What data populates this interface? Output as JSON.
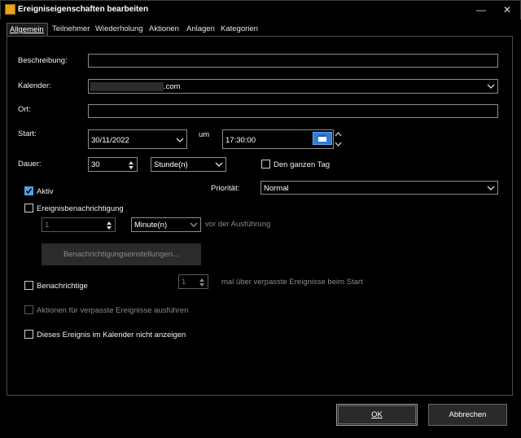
{
  "window": {
    "title": "Ereigniseigenschaften bearbeiten",
    "minimize": "—",
    "close": "✕"
  },
  "tabs": [
    {
      "label": "Allgemein",
      "active": true
    },
    {
      "label": "Teilnehmer"
    },
    {
      "label": "Wiederholung"
    },
    {
      "label": "Aktionen"
    },
    {
      "label": "Anlagen"
    },
    {
      "label": "Kategorien"
    }
  ],
  "form": {
    "description_label": "Beschreibung:",
    "description_value": "",
    "calendar_label": "Kalender:",
    "calendar_value": ".com",
    "location_label": "Ort:",
    "location_value": "",
    "start_label": "Start:",
    "start_date": "30/11/2022",
    "at_label": "um",
    "start_time": "17:30:00",
    "duration_label": "Dauer:",
    "duration_value": "30",
    "duration_unit": "Stunde(n)",
    "all_day_label": "Den ganzen Tag",
    "all_day_checked": false,
    "active_label": "Aktiv",
    "active_checked": true,
    "priority_label": "Priorität:",
    "priority_value": "Normal",
    "notification_label": "Ereignisbenachrichtigung",
    "notification_checked": false,
    "notify_amount": "1",
    "notify_unit": "Minute(n)",
    "notify_suffix": "vor der Ausführung",
    "notify_settings_button": "Benachrichtigungseinstellungen...",
    "notify_missed_label": "Benachrichtige",
    "notify_missed_checked": false,
    "notify_missed_amount": "1",
    "notify_missed_suffix": "mal über verpasste Ereignisse beim Start",
    "run_missed_label": "Aktionen für verpasste Ereignisse ausführen",
    "run_missed_checked": false,
    "hide_in_calendar_label": "Dieses Ereignis im Kalender nicht anzeigen",
    "hide_in_calendar_checked": false
  },
  "buttons": {
    "ok": "OK",
    "cancel": "Abbrechen"
  },
  "colors": {
    "background": "#000000",
    "accent": "#4ea2e8",
    "border": "#8c8c8c"
  }
}
